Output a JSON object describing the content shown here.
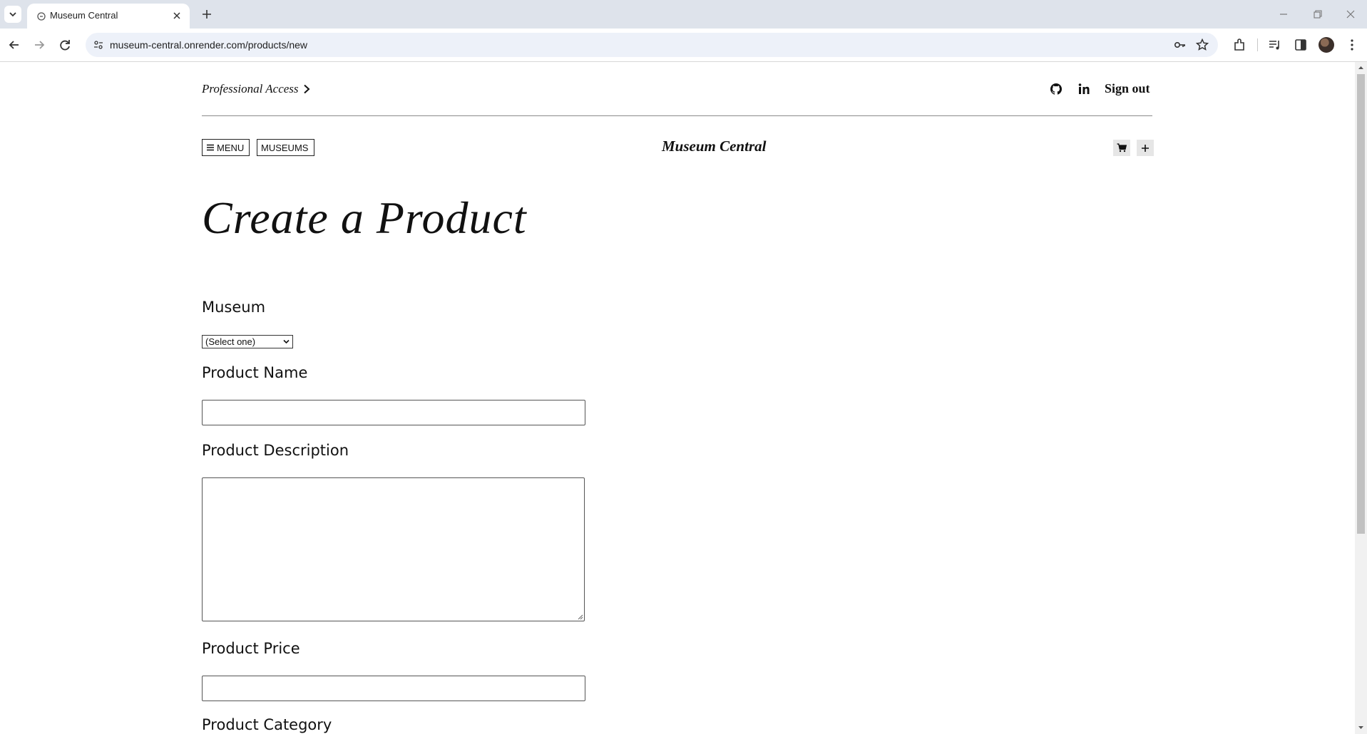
{
  "browser": {
    "tab_title": "Museum Central",
    "url": "museum-central.onrender.com/products/new"
  },
  "header": {
    "professional_access": "Professional Access",
    "sign_out": "Sign out",
    "menu_label": "MENU",
    "museums_label": "MUSEUMS",
    "brand": "Museum Central"
  },
  "form": {
    "title": "Create a Product",
    "museum_label": "Museum",
    "museum_selected": "(Select one)",
    "product_name_label": "Product Name",
    "product_name_value": "",
    "product_description_label": "Product Description",
    "product_description_value": "",
    "product_price_label": "Product Price",
    "product_price_value": "",
    "product_category_label": "Product Category"
  },
  "icons": {
    "cart": "cart-icon",
    "add": "plus-icon",
    "github": "github-icon",
    "linkedin": "linkedin-icon"
  }
}
